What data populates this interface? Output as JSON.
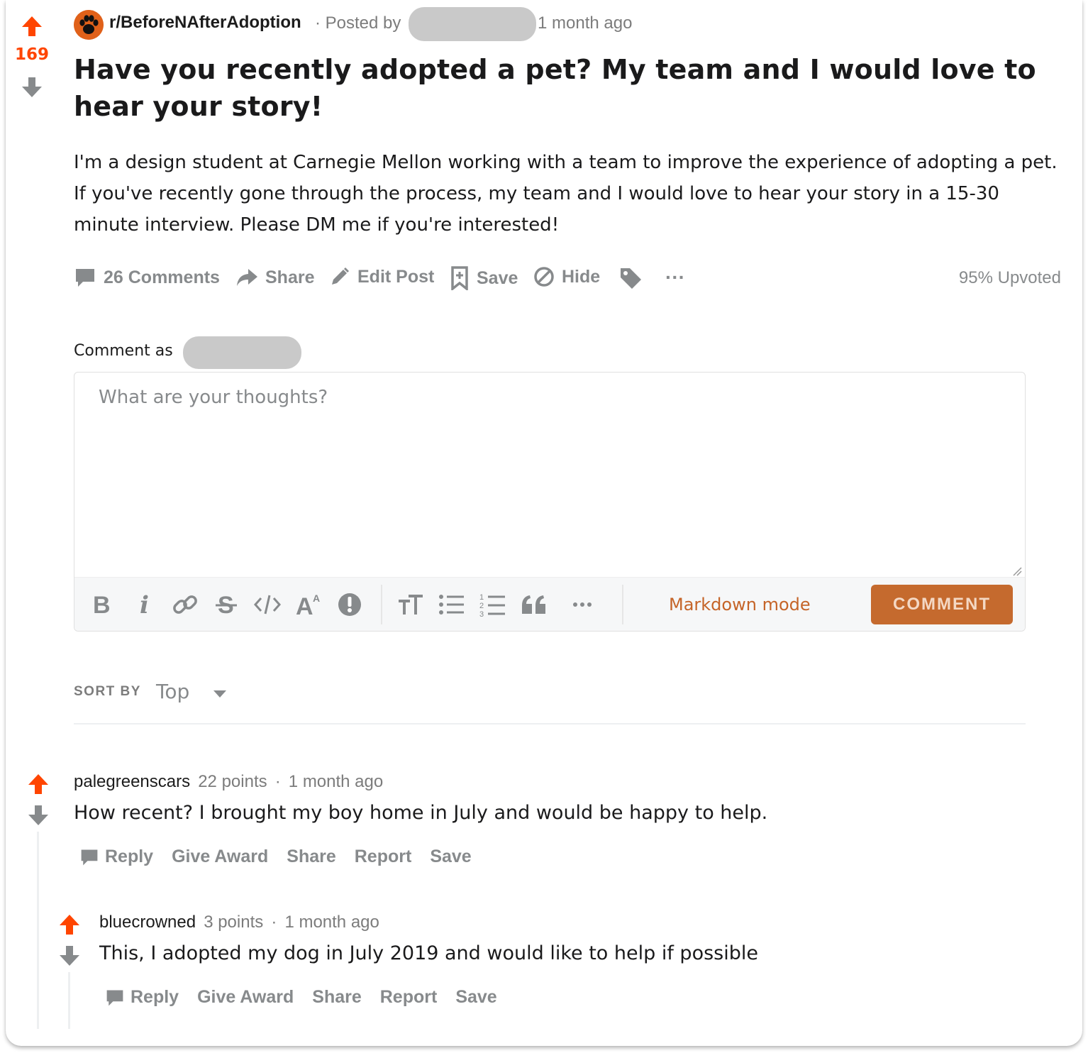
{
  "post": {
    "score": "169",
    "subreddit": "r/BeforeNAfterAdoption",
    "posted_by_prefix": "· Posted by",
    "time": "1 month ago",
    "title": "Have you recently adopted a pet? My team and I would love to hear your story!",
    "body": "I'm a design student at Carnegie Mellon working with a team to improve the experience of adopting a pet. If you've recently gone through the process, my team and I would love to hear your story in a 15-30 minute interview. Please DM me if you're interested!",
    "actions": {
      "comments": "26 Comments",
      "share": "Share",
      "edit": "Edit Post",
      "save": "Save",
      "hide": "Hide",
      "more": "···"
    },
    "upvoted": "95% Upvoted"
  },
  "composer": {
    "comment_as": "Comment as",
    "placeholder": "What are your thoughts?",
    "markdown_mode": "Markdown mode",
    "submit": "COMMENT"
  },
  "sort": {
    "label": "SORT BY",
    "value": "Top"
  },
  "comments": [
    {
      "user": "palegreenscars",
      "points": "22 points",
      "sep": "·",
      "time": "1 month ago",
      "text": "How recent? I brought my boy home in July and would be happy to help.",
      "actions": [
        "Reply",
        "Give Award",
        "Share",
        "Report",
        "Save"
      ]
    },
    {
      "user": "bluecrowned",
      "points": "3 points",
      "sep": "·",
      "time": "1 month ago",
      "text": "This, I adopted my dog in July 2019 and would like to help if possible",
      "actions": [
        "Reply",
        "Give Award",
        "Share",
        "Report",
        "Save"
      ]
    }
  ],
  "colors": {
    "upvote": "#ff4500",
    "downvote": "#878a8c",
    "accent": "#c56a2e"
  }
}
